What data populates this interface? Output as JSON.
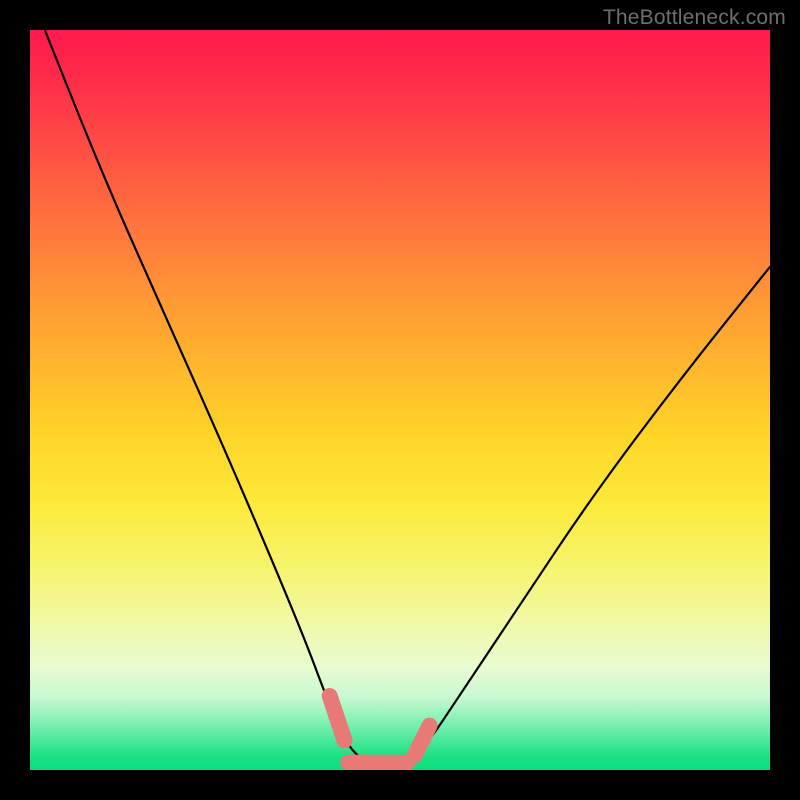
{
  "watermark": "TheBottleneck.com",
  "colors": {
    "page_bg": "#000000",
    "watermark": "#6f6f6f",
    "curve": "#000000",
    "marker_fill": "#e77a77",
    "gradient_top": "#ff1a4e",
    "gradient_bottom": "#0adf7e"
  },
  "chart_data": {
    "type": "line",
    "title": "",
    "xlabel": "",
    "ylabel": "",
    "xlim": [
      0,
      100
    ],
    "ylim": [
      0,
      100
    ],
    "note": "Axes are implicit / unlabeled. Background color encodes y (red=high bottleneck, green=low). Curve is a V-shaped bottleneck curve with flat minimum near zero around x≈42–52.",
    "series": [
      {
        "name": "bottleneck-curve",
        "x": [
          2,
          10,
          18,
          26,
          32,
          37,
          40,
          42,
          44,
          46,
          48,
          50,
          52,
          54,
          58,
          66,
          76,
          88,
          100
        ],
        "y": [
          100,
          80,
          62,
          44,
          30,
          18,
          10,
          5,
          2,
          1,
          1,
          1,
          2,
          4,
          10,
          22,
          37,
          53,
          68
        ]
      }
    ],
    "markers": [
      {
        "name": "left-knee-start",
        "x": 40.5,
        "y": 10
      },
      {
        "name": "left-knee-end",
        "x": 42.5,
        "y": 4
      },
      {
        "name": "valley-flat",
        "x_range": [
          43,
          51
        ],
        "y": 1
      },
      {
        "name": "right-knee-start",
        "x": 52,
        "y": 2
      },
      {
        "name": "right-knee-end",
        "x": 54,
        "y": 6
      }
    ]
  }
}
